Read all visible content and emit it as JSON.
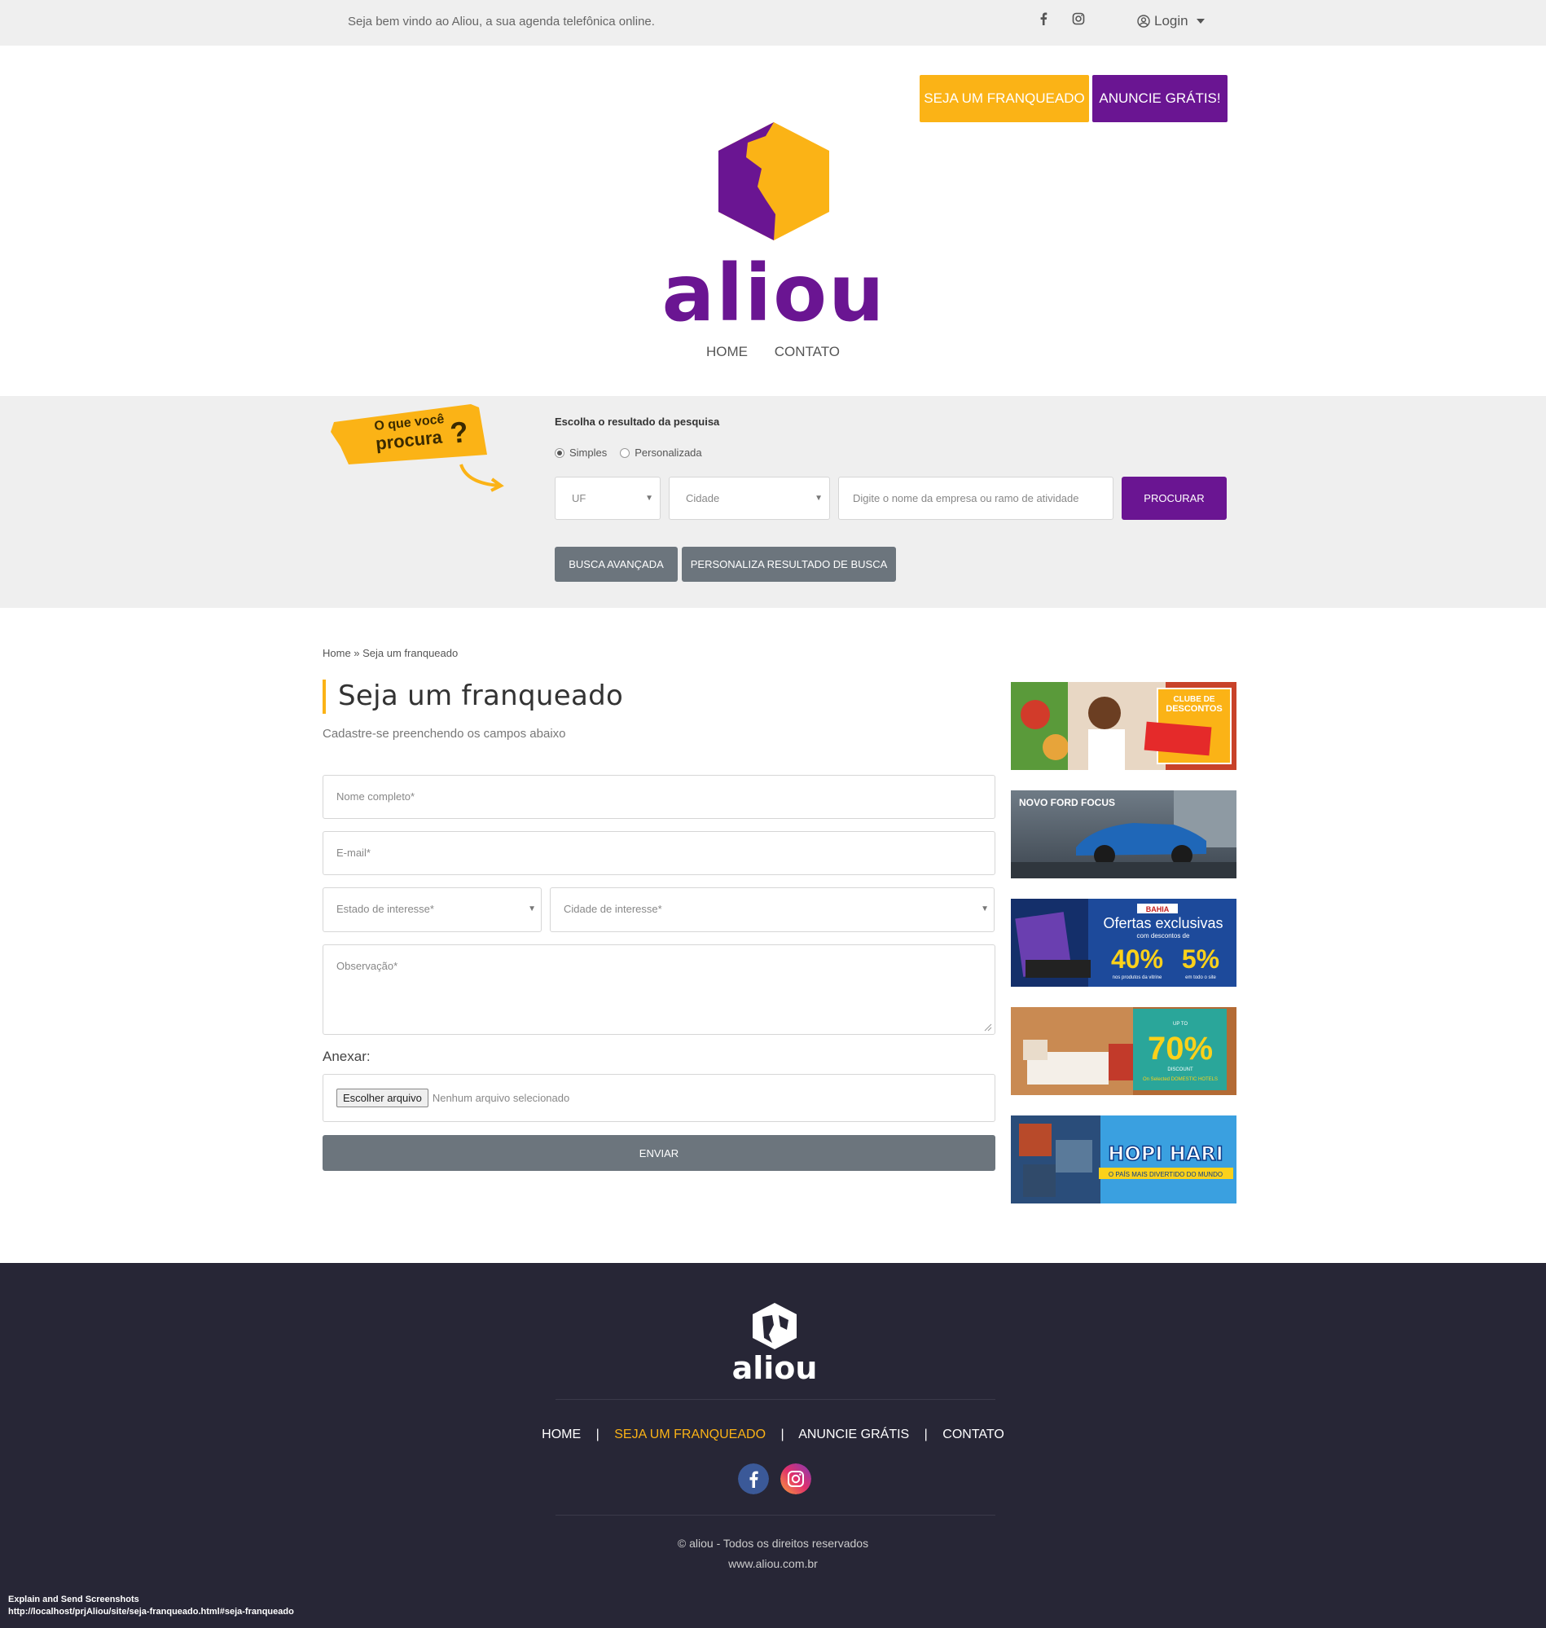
{
  "topbar": {
    "welcome": "Seja bem vindo ao Aliou, a sua agenda telefônica online.",
    "login_label": "Login"
  },
  "header": {
    "franqueado_button": "SEJA UM FRANQUEADO",
    "anuncie_button": "ANUNCIE GRÁTIS!",
    "logo_text": "aliou",
    "nav": [
      "HOME",
      "CONTATO"
    ]
  },
  "search": {
    "sticker_line1": "O que você",
    "sticker_line2": "procura",
    "title": "Escolha o resultado da pesquisa",
    "radio_simples": "Simples",
    "radio_personalizada": "Personalizada",
    "uf_value": "UF",
    "cidade_value": "Cidade",
    "query_placeholder": "Digite o nome da empresa ou ramo de atividade",
    "procurar_button": "PROCURAR",
    "busca_avancada_button": "BUSCA AVANÇADA",
    "personaliza_button": "PERSONALIZA RESULTADO DE BUSCA"
  },
  "page": {
    "breadcrumb": "Home » Seja um franqueado",
    "title": "Seja um franqueado",
    "subtitle": "Cadastre-se preenchendo os campos abaixo"
  },
  "form": {
    "nome_placeholder": "Nome completo*",
    "email_placeholder": "E-mail*",
    "estado_placeholder": "Estado de interesse*",
    "cidade_placeholder": "Cidade de interesse*",
    "obs_placeholder": "Observação*",
    "anexar_label": "Anexar:",
    "file_button": "Escolher arquivo",
    "file_status": "Nenhum arquivo selecionado",
    "enviar_button": "ENVIAR"
  },
  "ads": {
    "ad1_text1": "CLUBE DE",
    "ad1_text2": "DESCONTOS",
    "ad2_text": "NOVO FORD FOCUS",
    "ad3_brand": "BAHIA",
    "ad3_title": "Ofertas exclusivas",
    "ad3_sub": "com descontos de",
    "ad3_pct1": "40%",
    "ad3_pct2": "5%",
    "ad3_sub1": "nos produtos da vitrine",
    "ad3_sub2": "em todo o site",
    "ad4_upto": "UP TO",
    "ad4_pct": "70%",
    "ad4_discount": "DISCOUNT",
    "ad4_sub": "On Selected DOMESTIC HOTELS",
    "ad5_title": "HOPI HARI",
    "ad5_sub": "O PAÍS MAIS DIVERTIDO DO MUNDO"
  },
  "footer": {
    "logo_text": "aliou",
    "nav": [
      "HOME",
      "SEJA UM FRANQUEADO",
      "ANUNCIE GRÁTIS",
      "CONTATO"
    ],
    "separator": "|",
    "copyright": "© aliou - Todos os direitos reservados",
    "site": "www.aliou.com.br",
    "ext_title": "Explain and Send Screenshots",
    "ext_url": "http://localhost/prjAliou/site/seja-franqueado.html#seja-franqueado"
  },
  "colors": {
    "purple": "#6a1592",
    "yellow": "#fbb316",
    "footer_bg": "#272636",
    "gray_button": "#6c757d"
  }
}
